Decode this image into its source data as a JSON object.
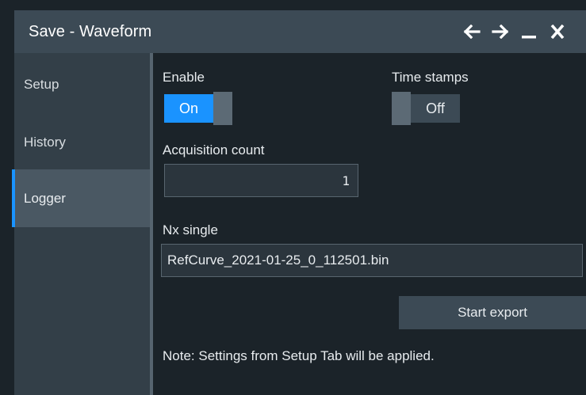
{
  "window": {
    "title": "Save - Waveform",
    "icons": [
      "back-arrow-icon",
      "forward-arrow-icon",
      "minimize-icon",
      "close-icon"
    ]
  },
  "sidebar": {
    "items": [
      {
        "label": "Setup",
        "active": false
      },
      {
        "label": "History",
        "active": false
      },
      {
        "label": "Logger",
        "active": true
      }
    ]
  },
  "logger": {
    "enable_label": "Enable",
    "enable_state": "On",
    "timestamps_label": "Time stamps",
    "timestamps_state": "Off",
    "acq_count_label": "Acquisition count",
    "acq_count_value": "1",
    "nx_single_label": "Nx single",
    "nx_single_value": "RefCurve_2021-01-25_0_112501.bin",
    "start_export_label": "Start export",
    "note": "Note: Settings from Setup Tab will be applied."
  },
  "colors": {
    "accent": "#1a93ff",
    "background": "#1b2329",
    "sidebar": "#333f48",
    "titlebar": "#3c4a55"
  }
}
